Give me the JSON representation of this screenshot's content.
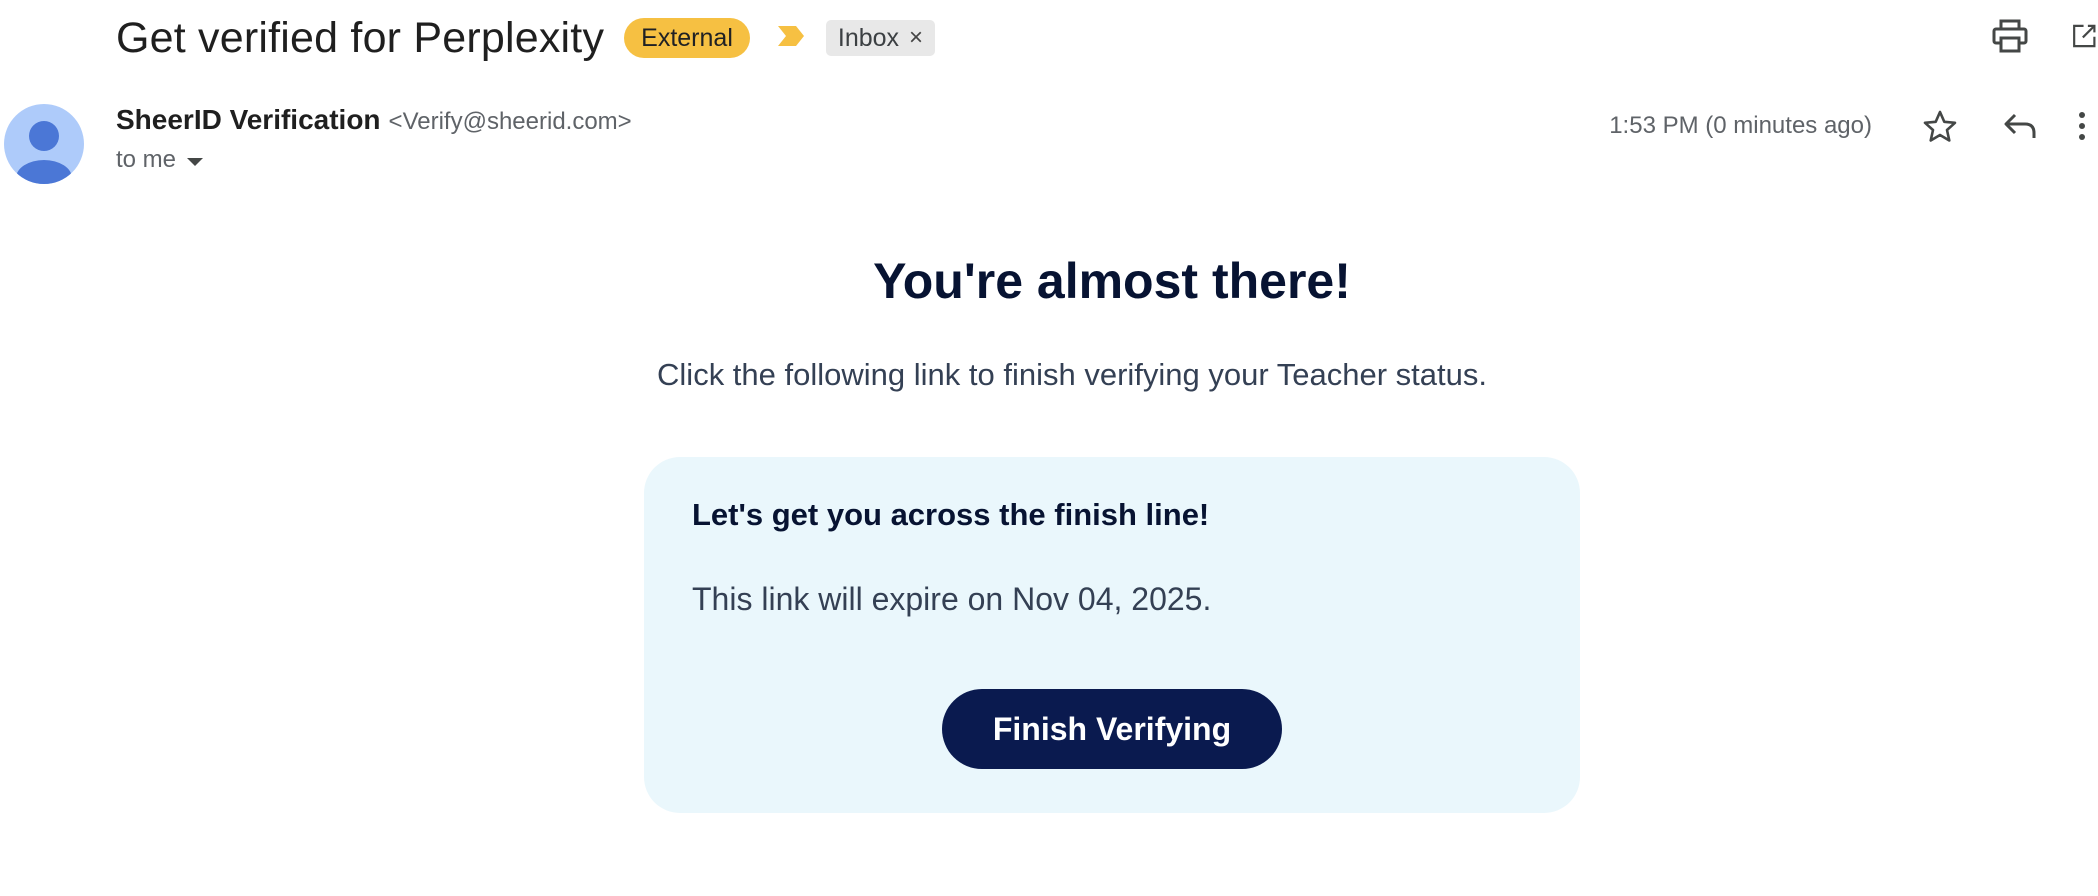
{
  "email": {
    "subject": "Get verified for Perplexity",
    "labels": {
      "external": "External",
      "inbox": "Inbox",
      "inbox_close": "×"
    },
    "sender": {
      "name": "SheerID Verification",
      "email": "<Verify@sheerid.com>",
      "recipient": "to me"
    },
    "timestamp": "1:53 PM (0 minutes ago)"
  },
  "body": {
    "headline": "You're almost there!",
    "instruction": "Click the following link to finish verifying your Teacher status.",
    "card": {
      "title": "Let's get you across the finish line!",
      "expiry": "This link will expire on Nov 04, 2025.",
      "button_label": "Finish Verifying"
    }
  },
  "icons": {
    "print": "print-icon",
    "open_in_new_window": "open-in-new-window-icon",
    "star": "star-icon",
    "reply": "reply-icon",
    "more": "more-vert-icon",
    "avatar": "default-avatar-icon",
    "importance": "importance-marker-icon",
    "recipient_dropdown": "dropdown-arrow-icon"
  },
  "colors": {
    "external_label": "#f6c042",
    "inbox_label": "#e8e8e8",
    "card_background": "#eaf7fc",
    "button_background": "#0a1a4f",
    "headline_text": "#071332"
  }
}
